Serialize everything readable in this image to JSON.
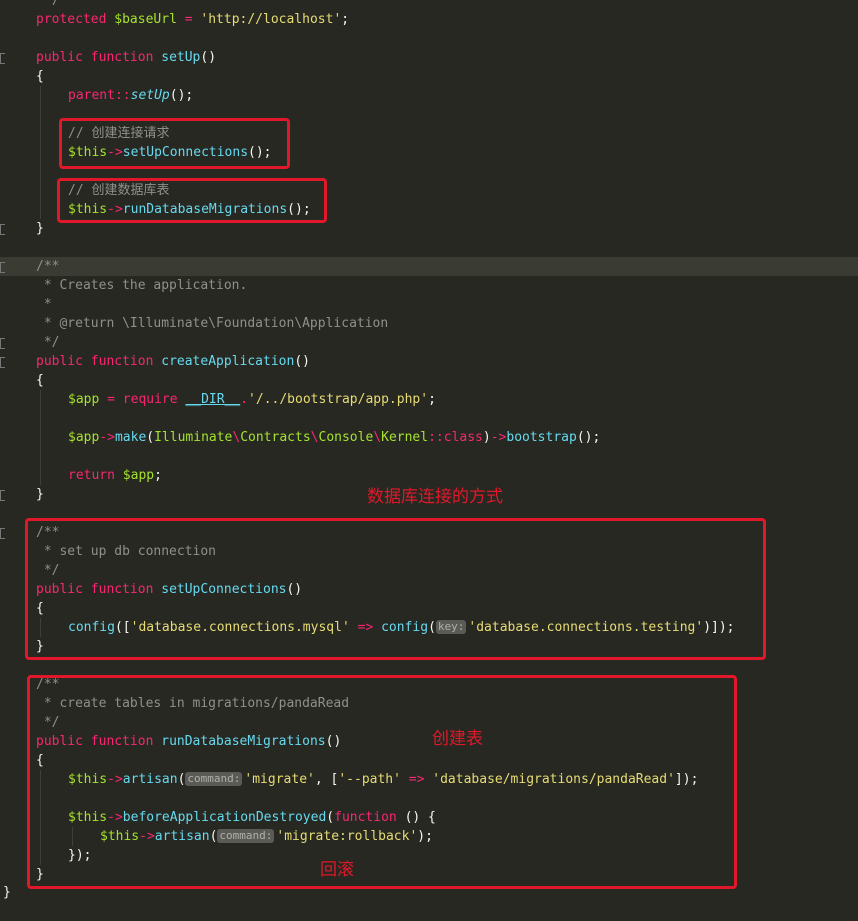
{
  "code": {
    "l0": "*/",
    "l1_kw": "protected",
    "l1_var": "$baseUrl",
    "l1_eq": " = ",
    "l1_str": "'http://localhost'",
    "l1_end": ";",
    "l3_kw1": "public",
    "l3_kw2": "function",
    "l3_name": "setUp",
    "parens": "()",
    "brace_open": "{",
    "brace_close": "}",
    "l5_parent": "parent",
    "l5_sep": "::",
    "l5_call": "setUp",
    "l5_end": "();",
    "c1": "// 创建连接请求",
    "this": "$this",
    "arrow": "->",
    "l8_call": "setUpConnections",
    "call_end": "();",
    "c2": "// 创建数据库表",
    "l11_call": "runDatabaseMigrations",
    "doc_open": "/**",
    "doc_creates": " * Creates the application.",
    "doc_star": " *",
    "doc_return": " * @return \\Illuminate\\Foundation\\Application",
    "doc_close": " */",
    "l18_name": "createApplication",
    "l20_var": "$app",
    "l20_eq": " = ",
    "l20_req": "require",
    "l20_dir": "__DIR__",
    "l20_dot": ".",
    "l20_str": "'/../bootstrap/app.php'",
    "l20_end": ";",
    "l22_make": "make",
    "l22_ns1": "Illuminate",
    "l22_bs": "\\",
    "l22_ns2": "Contracts",
    "l22_ns3": "Console",
    "l22_ns4": "Kernel",
    "l22_sep": "::",
    "l22_class": "class",
    "l22_boot": "bootstrap",
    "l24_ret": "return",
    "l24_var": "$app",
    "doc_setup": " * set up db connection",
    "l30_name": "setUpConnections",
    "l32_config": "config",
    "l32_open": "([",
    "l32_s1": "'database.connections.mysql'",
    "l32_arrow": " => ",
    "l32_paren": "(",
    "hint_key": "key:",
    "l32_s2": "'database.connections.testing'",
    "l32_end": ")]);",
    "doc_create": " * create tables in migrations/pandaRead",
    "l38_name": "runDatabaseMigrations",
    "artisan": "artisan",
    "hint_command": "command:",
    "l40_s1": "'migrate'",
    "l40_sep": ", [",
    "l40_s2": "'--path'",
    "l40_arrow": " => ",
    "l40_s3": "'database/migrations/pandaRead'",
    "l40_end": "]);",
    "l42_call": "beforeApplicationDestroyed",
    "l42_func": "function",
    "l42_rest": " () {",
    "l43_s": "'migrate:rollback'",
    "l43_end": ");",
    "l44": "});"
  },
  "annotations": {
    "db_connection": "数据库连接的方式",
    "create_table": "创建表",
    "rollback": "回滚"
  }
}
